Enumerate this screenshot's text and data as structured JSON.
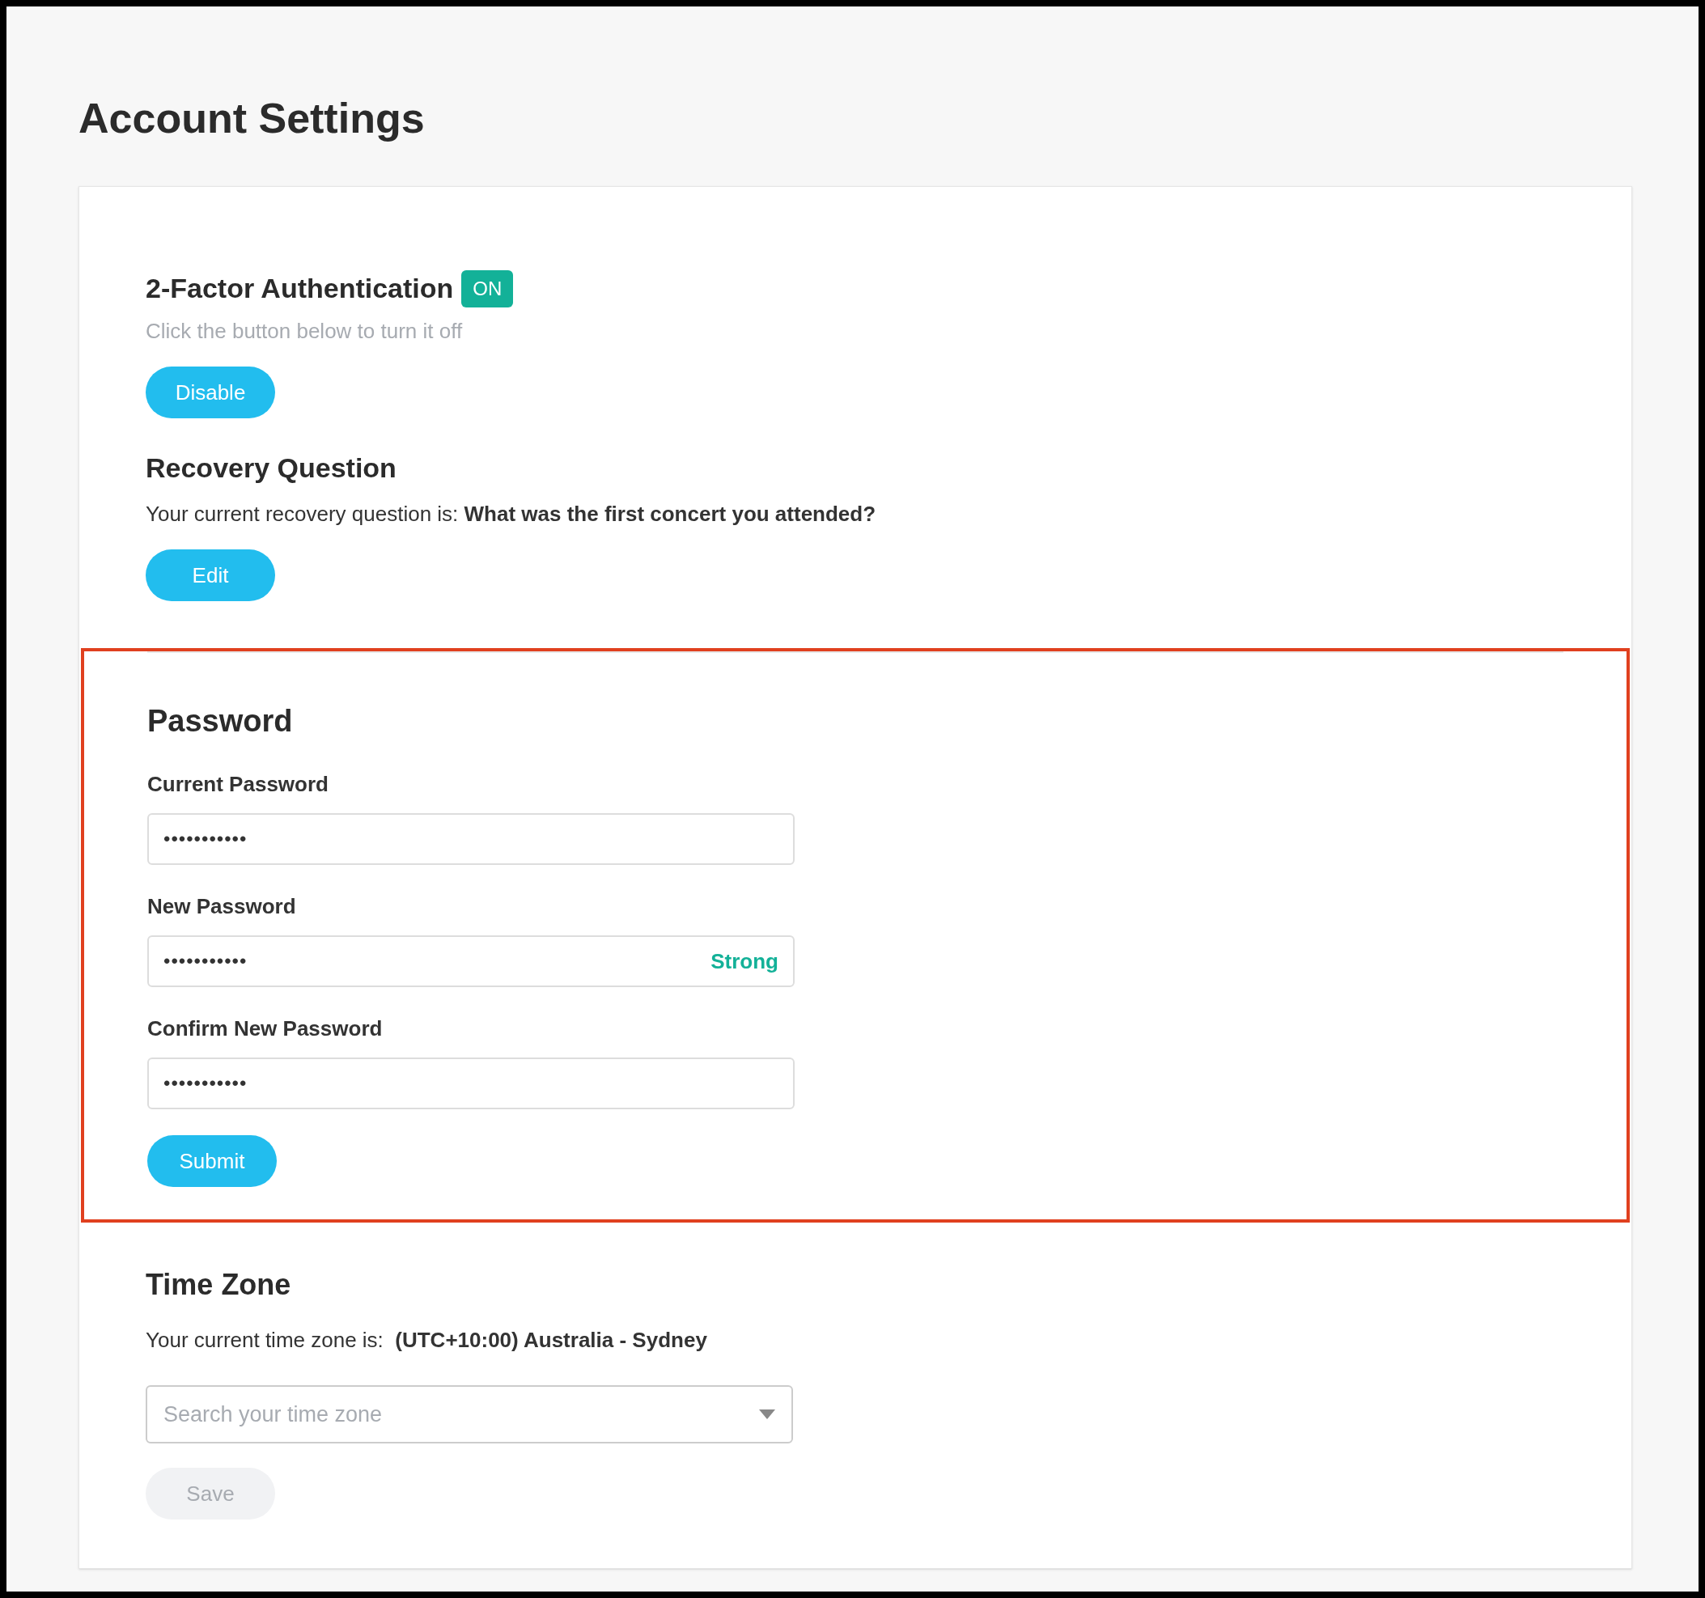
{
  "page_title": "Account Settings",
  "two_factor": {
    "title": "2-Factor Authentication",
    "badge": "ON",
    "on": true,
    "hint": "Click the button below to turn it off",
    "button": "Disable"
  },
  "recovery": {
    "title": "Recovery Question",
    "text": "Your current recovery question is: **What was the first concert you attended?**",
    "button": "Edit"
  },
  "password": {
    "highlighted": true,
    "title": "Password",
    "fields": [
      {
        "label": "Current Password",
        "value": "•••••••••••"
      },
      {
        "label": "New Password",
        "value": "•••••••••••",
        "strength": "Strong"
      },
      {
        "label": "Confirm New Password",
        "value": "•••••••••••"
      }
    ],
    "button": {
      "label": "Submit",
      "disabled": false
    }
  },
  "time_zone": {
    "title": "Time Zone",
    "text": "Your current time zone is:  **(UTC+10:00) Australia - Sydney**",
    "select": {
      "placeholder": "Search your time zone"
    },
    "button": {
      "label": "Save",
      "disabled": true
    }
  }
}
